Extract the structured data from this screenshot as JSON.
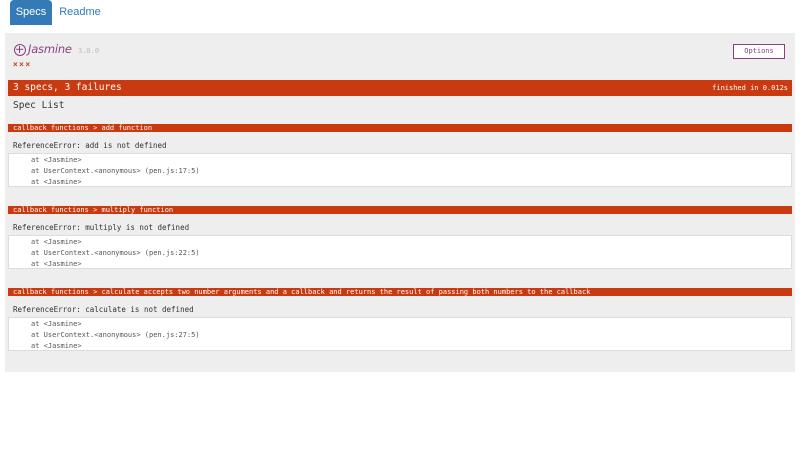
{
  "tabs": [
    {
      "label": "Specs",
      "active": true
    },
    {
      "label": "Readme",
      "active": false
    }
  ],
  "reporter": {
    "brand": "Jasmine",
    "version": "3.0.0",
    "markers": "×××",
    "options_label": "Options",
    "summary": "3 specs, 3 failures",
    "duration": "finished in 0.012s",
    "spec_list_title": "Spec List",
    "accent_color": "#ca3a11",
    "brand_color": "#8a4182"
  },
  "failures": [
    {
      "title": "callback functions > add function",
      "message": "ReferenceError: add is not defined",
      "stack": [
        "at <Jasmine>",
        "at UserContext.<anonymous> (pen.js:17:5)",
        "at <Jasmine>"
      ]
    },
    {
      "title": "callback functions > multiply function",
      "message": "ReferenceError: multiply is not defined",
      "stack": [
        "at <Jasmine>",
        "at UserContext.<anonymous> (pen.js:22:5)",
        "at <Jasmine>"
      ]
    },
    {
      "title": "callback functions > calculate accepts two number arguments and a callback and returns the result of passing both numbers to the callback",
      "message": "ReferenceError: calculate is not defined",
      "stack": [
        "at <Jasmine>",
        "at UserContext.<anonymous> (pen.js:27:5)",
        "at <Jasmine>"
      ]
    }
  ]
}
